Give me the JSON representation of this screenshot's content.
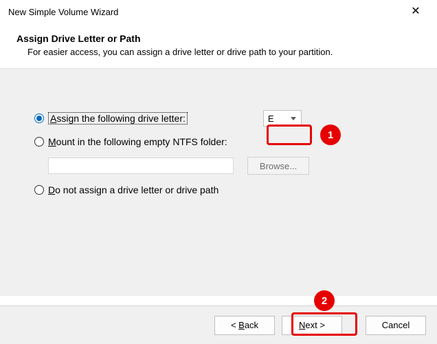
{
  "window": {
    "title": "New Simple Volume Wizard"
  },
  "header": {
    "title": "Assign Drive Letter or Path",
    "subtitle": "For easier access, you can assign a drive letter or drive path to your partition."
  },
  "options": {
    "assign_letter": {
      "label_pre": "",
      "label_u": "A",
      "label_post": "ssign the following drive letter:",
      "selected": true,
      "drive_value": "E"
    },
    "mount_folder": {
      "label_pre": "",
      "label_u": "M",
      "label_post": "ount in the following empty NTFS folder:",
      "folder_value": "",
      "browse_label": "Browse..."
    },
    "no_assign": {
      "label_pre": "",
      "label_u": "D",
      "label_post": "o not assign a drive letter or drive path"
    }
  },
  "footer": {
    "back_pre": "< ",
    "back_u": "B",
    "back_post": "ack",
    "next_pre": "",
    "next_u": "N",
    "next_post": "ext >",
    "cancel": "Cancel"
  },
  "annotations": {
    "badge1": "1",
    "badge2": "2"
  }
}
